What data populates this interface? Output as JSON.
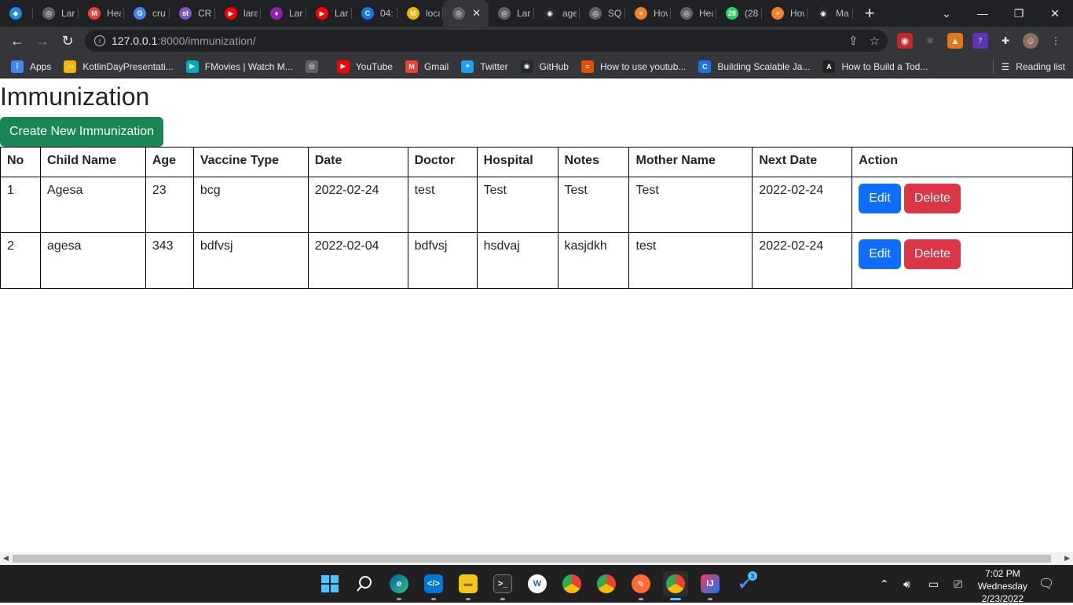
{
  "tabs": [
    {
      "label": "",
      "color": "#1e88e5",
      "glyph": "◆"
    },
    {
      "label": "Lara",
      "color": "#5f6368",
      "glyph": "◎"
    },
    {
      "label": "Hea",
      "color": "#ea4335",
      "glyph": "M"
    },
    {
      "label": "cru",
      "color": "#4285f4",
      "glyph": "G"
    },
    {
      "label": "CRU",
      "color": "#7e57c2",
      "glyph": "st"
    },
    {
      "label": "lara",
      "color": "#ff0000",
      "glyph": "▶"
    },
    {
      "label": "Lara",
      "color": "#8e24aa",
      "glyph": "♦"
    },
    {
      "label": "Lara",
      "color": "#ff0000",
      "glyph": "▶"
    },
    {
      "label": "04:",
      "color": "#1a73e8",
      "glyph": "C"
    },
    {
      "label": "loca",
      "color": "#f4b400",
      "glyph": "M"
    },
    {
      "label": "",
      "color": "#5f6368",
      "glyph": "◎",
      "active": true
    },
    {
      "label": "Lara",
      "color": "#5f6368",
      "glyph": "◎"
    },
    {
      "label": "age",
      "color": "#24292e",
      "glyph": "◉"
    },
    {
      "label": "SQL",
      "color": "#5f6368",
      "glyph": "◎"
    },
    {
      "label": "How",
      "color": "#f48024",
      "glyph": "≡"
    },
    {
      "label": "Hea",
      "color": "#5f6368",
      "glyph": "◎"
    },
    {
      "label": "(28",
      "color": "#25d366",
      "glyph": "28"
    },
    {
      "label": "How",
      "color": "#f48024",
      "glyph": "≡"
    },
    {
      "label": "Ma",
      "color": "#24292e",
      "glyph": "◉"
    }
  ],
  "address": {
    "host": "127.0.0.1",
    "path": ":8000/immunization/"
  },
  "bookmarks": [
    {
      "label": "Apps",
      "color": "#4285f4",
      "glyph": "⋮"
    },
    {
      "label": "KotlinDayPresentati...",
      "color": "#f4b400",
      "glyph": "▭"
    },
    {
      "label": "FMovies | Watch M...",
      "color": "#00acc1",
      "glyph": "▶"
    },
    {
      "label": "",
      "color": "#5f6368",
      "glyph": "◎"
    },
    {
      "label": "YouTube",
      "color": "#ff0000",
      "glyph": "▶"
    },
    {
      "label": "Gmail",
      "color": "#ea4335",
      "glyph": "M"
    },
    {
      "label": "Twitter",
      "color": "#1da1f2",
      "glyph": "✦"
    },
    {
      "label": "GitHub",
      "color": "#24292e",
      "glyph": "◉"
    },
    {
      "label": "How to use youtub...",
      "color": "#e65100",
      "glyph": "≡"
    },
    {
      "label": "Building Scalable Ja...",
      "color": "#1a73e8",
      "glyph": "C"
    },
    {
      "label": "How to Build a Tod...",
      "color": "#212121",
      "glyph": "A"
    }
  ],
  "reading_list": "Reading list",
  "page": {
    "title": "Immunization",
    "create_label": "Create New Immunization",
    "columns": [
      "No",
      "Child Name",
      "Age",
      "Vaccine Type",
      "Date",
      "Doctor",
      "Hospital",
      "Notes",
      "Mother Name",
      "Next Date",
      "Action"
    ],
    "rows": [
      {
        "no": "1",
        "child": "Agesa",
        "age": "23",
        "vaccine": "bcg",
        "date": "2022-02-24",
        "doctor": "test",
        "hospital": "Test",
        "notes": "Test",
        "mother": "Test",
        "next": "2022-02-24"
      },
      {
        "no": "2",
        "child": "agesa",
        "age": "343",
        "vaccine": "bdfvsj",
        "date": "2022-02-04",
        "doctor": "bdfvsj",
        "hospital": "hsdvaj",
        "notes": "kasjdkh",
        "mother": "test",
        "next": "2022-02-24"
      }
    ],
    "edit_label": "Edit",
    "delete_label": "Delete"
  },
  "extension_badge": "7",
  "taskbar_badge": "3",
  "clock": {
    "time": "7:02 PM",
    "day": "Wednesday",
    "date": "2/23/2022"
  },
  "colors": {
    "create": "#198754",
    "edit": "#0d6efd",
    "delete": "#dc3545"
  }
}
